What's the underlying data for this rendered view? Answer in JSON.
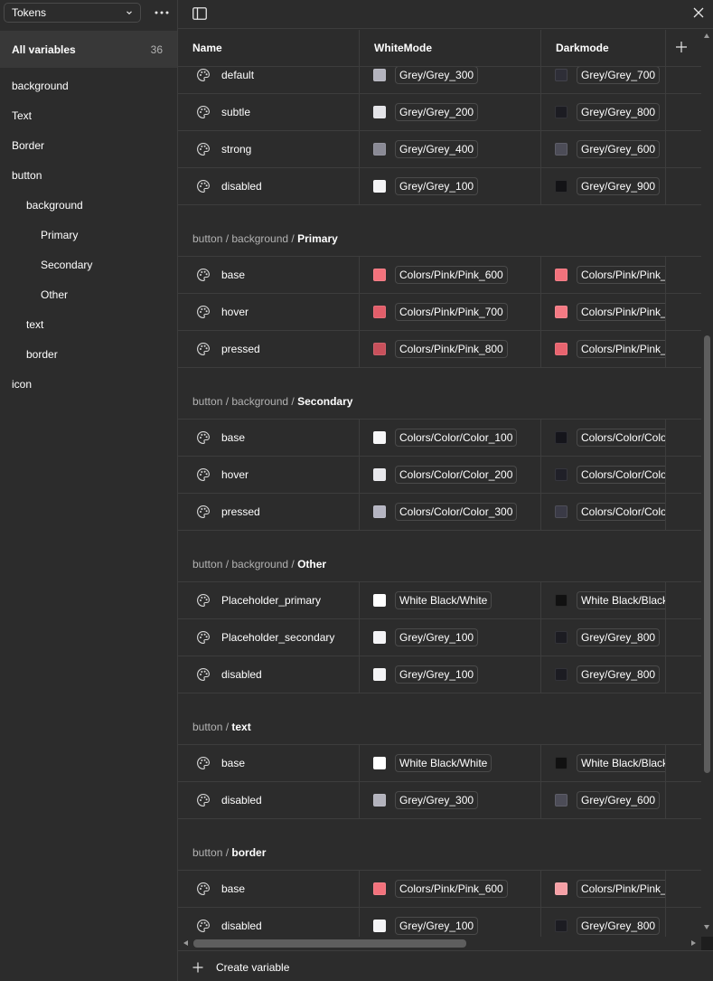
{
  "sidebar": {
    "collection": "Tokens",
    "all_variables_label": "All variables",
    "all_variables_count": "36",
    "groups": [
      {
        "label": "background",
        "level": 0
      },
      {
        "label": "Text",
        "level": 0
      },
      {
        "label": "Border",
        "level": 0
      },
      {
        "label": "button",
        "level": 0
      },
      {
        "label": "background",
        "level": 1
      },
      {
        "label": "Primary",
        "level": 2
      },
      {
        "label": "Secondary",
        "level": 2
      },
      {
        "label": "Other",
        "level": 2
      },
      {
        "label": "text",
        "level": 1
      },
      {
        "label": "border",
        "level": 1
      },
      {
        "label": "icon",
        "level": 0
      }
    ]
  },
  "table": {
    "columns": {
      "name": "Name",
      "mode1": "WhiteMode",
      "mode2": "Darkmode"
    },
    "blocks": [
      {
        "type": "row",
        "name": "default",
        "white": {
          "swatch": "#b3b3bd",
          "label": "Grey/Grey_300"
        },
        "dark": {
          "swatch": "#2e2e37",
          "label": "Grey/Grey_700"
        }
      },
      {
        "type": "row",
        "name": "subtle",
        "white": {
          "swatch": "#e4e4e8",
          "label": "Grey/Grey_200"
        },
        "dark": {
          "swatch": "#1c1c22",
          "label": "Grey/Grey_800"
        }
      },
      {
        "type": "row",
        "name": "strong",
        "white": {
          "swatch": "#8a8a95",
          "label": "Grey/Grey_400"
        },
        "dark": {
          "swatch": "#4c4c57",
          "label": "Grey/Grey_600"
        }
      },
      {
        "type": "row",
        "name": "disabled",
        "white": {
          "swatch": "#f4f4f6",
          "label": "Grey/Grey_100"
        },
        "dark": {
          "swatch": "#131316",
          "label": "Grey/Grey_900"
        }
      },
      {
        "type": "section",
        "path": "button / background / ",
        "leaf": "Primary"
      },
      {
        "type": "row",
        "name": "base",
        "white": {
          "swatch": "#f2727c",
          "label": "Colors/Pink/Pink_600"
        },
        "dark": {
          "swatch": "#f2727c",
          "label": "Colors/Pink/Pink_"
        }
      },
      {
        "type": "row",
        "name": "hover",
        "white": {
          "swatch": "#e25e6a",
          "label": "Colors/Pink/Pink_700"
        },
        "dark": {
          "swatch": "#f47a84",
          "label": "Colors/Pink/Pink_"
        }
      },
      {
        "type": "row",
        "name": "pressed",
        "white": {
          "swatch": "#c8505b",
          "label": "Colors/Pink/Pink_800"
        },
        "dark": {
          "swatch": "#e8646f",
          "label": "Colors/Pink/Pink_"
        }
      },
      {
        "type": "section",
        "path": "button / background / ",
        "leaf": "Secondary"
      },
      {
        "type": "row",
        "name": "base",
        "white": {
          "swatch": "#f7f7f8",
          "label": "Colors/Color/Color_100"
        },
        "dark": {
          "swatch": "#15151b",
          "label": "Colors/Color/Colo"
        }
      },
      {
        "type": "row",
        "name": "hover",
        "white": {
          "swatch": "#e8e8ec",
          "label": "Colors/Color/Color_200"
        },
        "dark": {
          "swatch": "#202028",
          "label": "Colors/Color/Colo"
        }
      },
      {
        "type": "row",
        "name": "pressed",
        "white": {
          "swatch": "#b5b5c2",
          "label": "Colors/Color/Color_300"
        },
        "dark": {
          "swatch": "#3a3a46",
          "label": "Colors/Color/Colo"
        }
      },
      {
        "type": "section",
        "path": "button / background / ",
        "leaf": "Other"
      },
      {
        "type": "row",
        "name": "Placeholder_primary",
        "white": {
          "swatch": "#ffffff",
          "label": "White Black/White"
        },
        "dark": {
          "swatch": "#111111",
          "label": "White Black/Black"
        }
      },
      {
        "type": "row",
        "name": "Placeholder_secondary",
        "white": {
          "swatch": "#f4f4f6",
          "label": "Grey/Grey_100"
        },
        "dark": {
          "swatch": "#1c1c22",
          "label": "Grey/Grey_800"
        }
      },
      {
        "type": "row",
        "name": "disabled",
        "white": {
          "swatch": "#f4f4f6",
          "label": "Grey/Grey_100"
        },
        "dark": {
          "swatch": "#1c1c22",
          "label": "Grey/Grey_800"
        }
      },
      {
        "type": "section",
        "path": "button / ",
        "leaf": "text"
      },
      {
        "type": "row",
        "name": "base",
        "white": {
          "swatch": "#ffffff",
          "label": "White Black/White"
        },
        "dark": {
          "swatch": "#111111",
          "label": "White Black/Black"
        }
      },
      {
        "type": "row",
        "name": "disabled",
        "white": {
          "swatch": "#b3b3bd",
          "label": "Grey/Grey_300"
        },
        "dark": {
          "swatch": "#4c4c57",
          "label": "Grey/Grey_600"
        }
      },
      {
        "type": "section",
        "path": "button / ",
        "leaf": "border"
      },
      {
        "type": "row",
        "name": "base",
        "white": {
          "swatch": "#f2727c",
          "label": "Colors/Pink/Pink_600"
        },
        "dark": {
          "swatch": "#f5a0a6",
          "label": "Colors/Pink/Pink_"
        }
      },
      {
        "type": "row",
        "name": "disabled",
        "white": {
          "swatch": "#f4f4f6",
          "label": "Grey/Grey_100"
        },
        "dark": {
          "swatch": "#1c1c22",
          "label": "Grey/Grey_800"
        }
      }
    ]
  },
  "footer": {
    "create_label": "Create variable"
  }
}
